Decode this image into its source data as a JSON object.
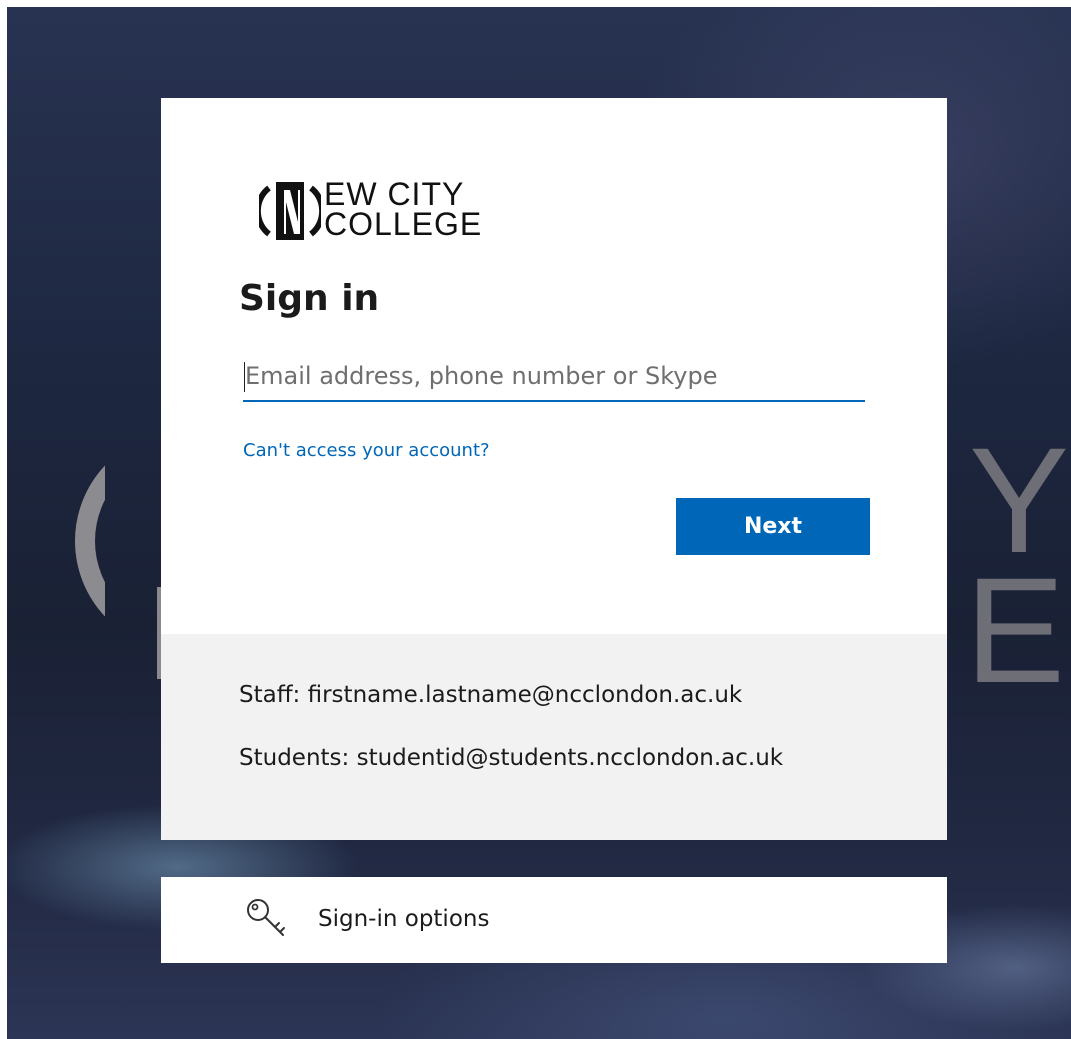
{
  "logo": {
    "line1": "EW CITY",
    "line2": "COLLEGE"
  },
  "signin": {
    "title": "Sign in",
    "email_placeholder": "Email address, phone number or Skype",
    "email_value": "",
    "cant_access_link": "Can't access your account?",
    "next_label": "Next"
  },
  "footer": {
    "staff_hint": "Staff: firstname.lastname@ncclondon.ac.uk",
    "students_hint": "Students: studentid@students.ncclondon.ac.uk"
  },
  "options": {
    "label": "Sign-in options",
    "icon": "key-icon"
  },
  "colors": {
    "accent": "#0067b8",
    "footer_bg": "#f2f2f2",
    "text": "#1b1b1b"
  }
}
